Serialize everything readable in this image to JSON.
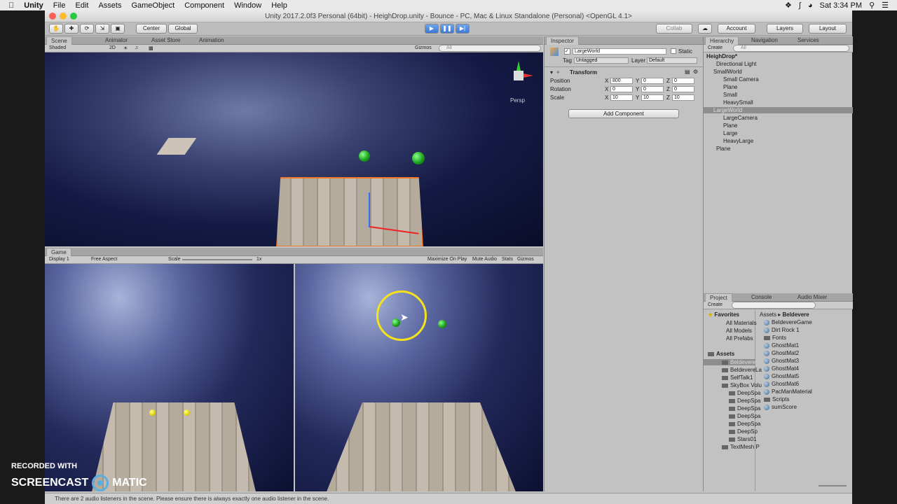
{
  "menubar": {
    "app": "Unity",
    "items": [
      "File",
      "Edit",
      "Assets",
      "GameObject",
      "Component",
      "Window",
      "Help"
    ],
    "clock": "Sat 3:34 PM"
  },
  "window_title": "Unity 2017.2.0f3 Personal (64bit) - HeighDrop.unity - Bounce - PC, Mac & Linux Standalone (Personal) <OpenGL 4.1>",
  "toolbar": {
    "center": "Center",
    "global": "Global",
    "collab": "Collab",
    "account": "Account",
    "layers": "Layers",
    "layout": "Layout"
  },
  "scene": {
    "tabs": [
      "Scene",
      "Animator",
      "Asset Store",
      "Animation"
    ],
    "shading": "Shaded",
    "mode2d": "2D",
    "gizmos": "Gizmos",
    "search_placeholder": "All",
    "persp": "Persp"
  },
  "game": {
    "tab": "Game",
    "display": "Display 1",
    "aspect": "Free Aspect",
    "scale_label": "Scale",
    "scale_value": "1x",
    "maximize": "Maximize On Play",
    "mute": "Mute Audio",
    "stats": "Stats",
    "gizmos": "Gizmos"
  },
  "inspector": {
    "tab": "Inspector",
    "name": "LargeWorld",
    "static": "Static",
    "tag_label": "Tag",
    "tag": "Untagged",
    "layer_label": "Layer",
    "layer": "Default",
    "transform": "Transform",
    "rows": [
      {
        "label": "Position",
        "x": "800",
        "y": "0",
        "z": "0"
      },
      {
        "label": "Rotation",
        "x": "0",
        "y": "0",
        "z": "0"
      },
      {
        "label": "Scale",
        "x": "10",
        "y": "10",
        "z": "10"
      }
    ],
    "axis": [
      "X",
      "Y",
      "Z"
    ],
    "add_component": "Add Component"
  },
  "hierarchy": {
    "tabs": [
      "Hierarchy",
      "Navigation",
      "Services"
    ],
    "create": "Create",
    "search_placeholder": "All",
    "items": [
      "HeighDrop*",
      "Directional Light",
      "SmallWorld",
      "Small Camera",
      "Plane",
      "Small",
      "HeavySmall",
      "LargeWorld",
      "LargeCamera",
      "Plane",
      "Large",
      "HeavyLarge",
      "Plane"
    ]
  },
  "project": {
    "tabs": [
      "Project",
      "Console",
      "Audio Mixer"
    ],
    "create": "Create",
    "favorites": "Favorites",
    "fav_items": [
      "All Materials",
      "All Models",
      "All Prefabs"
    ],
    "assets": "Assets",
    "tree": [
      "Beldevere",
      "BeldevereLa",
      "SelfTalk1",
      "SkyBox Volu",
      "DeepSpa",
      "DeepSpa",
      "DeepSpa",
      "DeepSpa",
      "DeepSpa",
      "DeepSp",
      "Stars01",
      "TextMesh P"
    ],
    "breadcrumb": [
      "Assets",
      "Beldevere"
    ],
    "files": [
      "BeldevereGame",
      "Dirt Rock 1",
      "Fonts",
      "GhostMat1",
      "GhostMat2",
      "GhostMat3",
      "GhostMat4",
      "GhostMat5",
      "GhostMat6",
      "PacManMaterial",
      "Scripts",
      "sumScore"
    ]
  },
  "status": "There are 2 audio listeners in the scene. Please ensure there is always exactly one audio listener in the scene.",
  "watermark": {
    "line1": "RECORDED WITH",
    "line2a": "SCREENCAST",
    "line2b": "MATIC"
  }
}
